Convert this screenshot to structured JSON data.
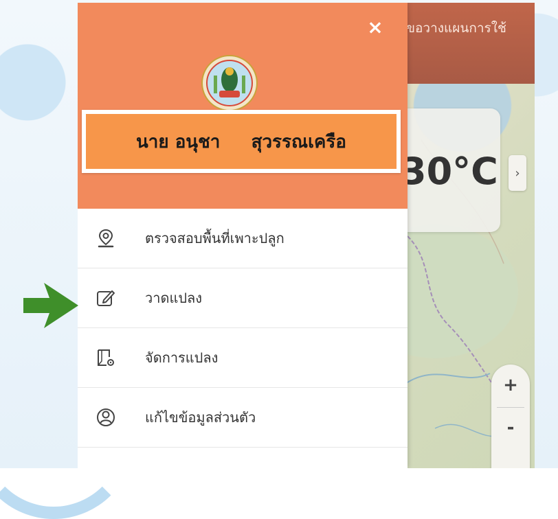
{
  "map": {
    "header_title": "ขอวางแผนการใช้",
    "temperature": "30°C",
    "next_label": "›",
    "zoom_in": "+",
    "zoom_out": "-"
  },
  "drawer": {
    "close_label": "×",
    "user_name": "นาย อนุชา     สุวรรณเครือ",
    "menu": [
      {
        "label": "ตรวจสอบพื้นที่เพาะปลูก",
        "icon": "location-pin-icon"
      },
      {
        "label": "วาดแปลง",
        "icon": "edit-icon"
      },
      {
        "label": "จัดการแปลง",
        "icon": "plot-settings-icon"
      },
      {
        "label": "แก้ไขข้อมูลส่วนตัว",
        "icon": "user-profile-icon"
      }
    ]
  },
  "colors": {
    "drawer_header": "#f28a5c",
    "name_box": "#f7964a",
    "arrow": "#3f8f2a"
  }
}
